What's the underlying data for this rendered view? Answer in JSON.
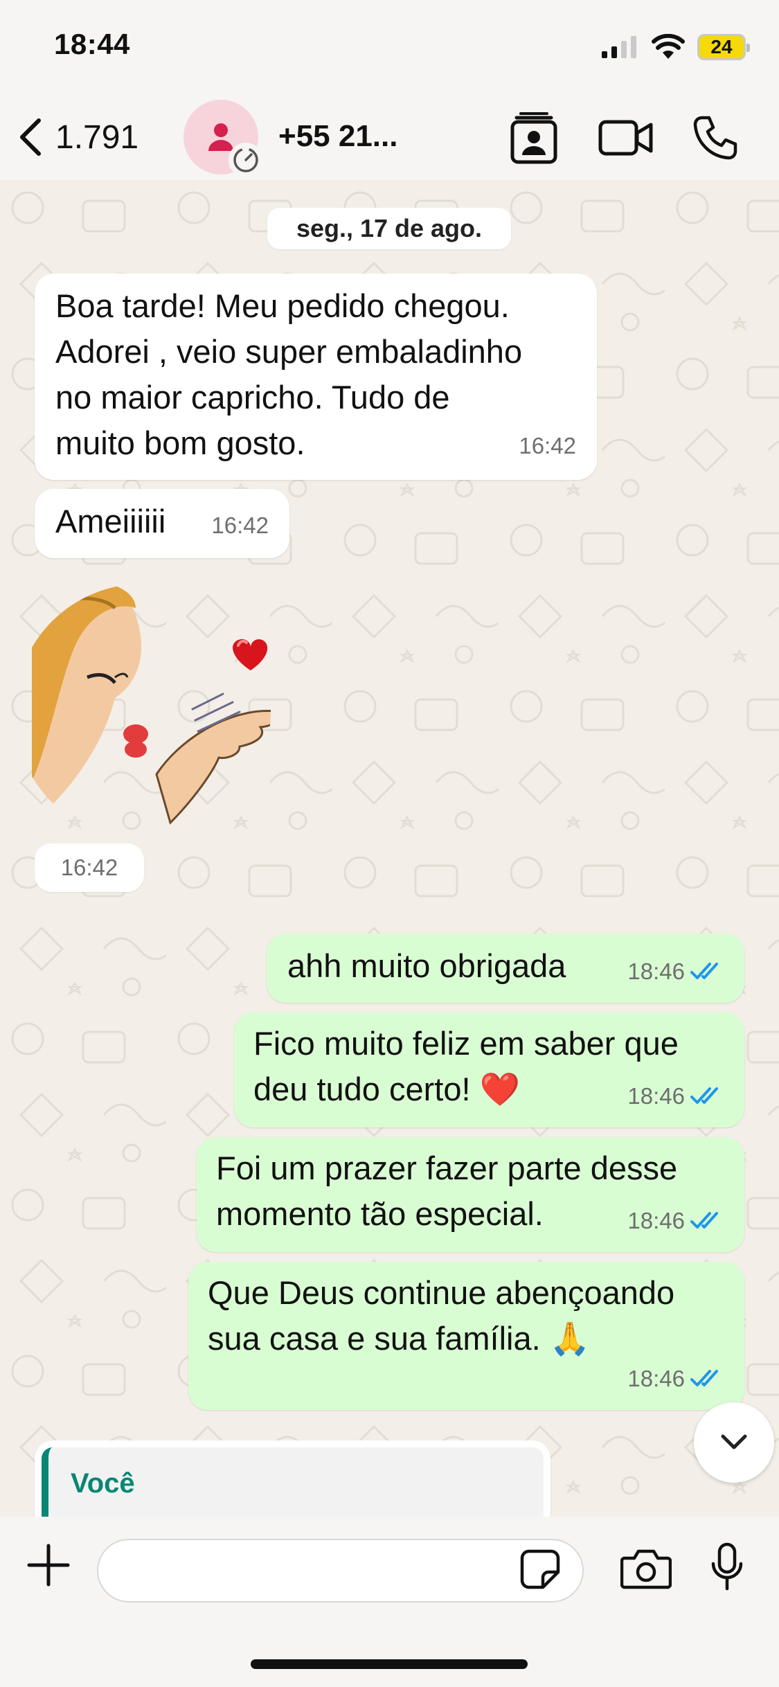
{
  "status_bar": {
    "time": "18:44",
    "battery": "24"
  },
  "header": {
    "back_count": "1.791",
    "contact_name": "+55 21..."
  },
  "chat": {
    "date_chip": "seg., 17 de ago.",
    "messages": [
      {
        "direction": "incoming",
        "text": "Boa tarde! Meu pedido chegou.\nAdorei  , veio super embaladinho\nno maior capricho.  Tudo de\nmuito bom gosto.",
        "time": "16:42"
      },
      {
        "direction": "incoming",
        "text": "Ameiiiiii",
        "time": "16:42"
      },
      {
        "direction": "incoming",
        "type": "sticker",
        "sticker": "kiss-blowing-woman",
        "time": "16:42"
      },
      {
        "direction": "outgoing",
        "text": "ahh muito obrigada",
        "time": "18:46",
        "status": "read"
      },
      {
        "direction": "outgoing",
        "text": "Fico muito feliz em saber que\ndeu tudo certo! ❤️",
        "time": "18:46",
        "status": "read"
      },
      {
        "direction": "outgoing",
        "text": "Foi um prazer fazer parte desse\nmomento tão especial.",
        "time": "18:46",
        "status": "read"
      },
      {
        "direction": "outgoing",
        "text": "Que Deus continue abençoando\nsua casa e sua família. 🙏",
        "time": "18:46",
        "status": "read"
      }
    ],
    "reply_preview": {
      "name": "Você"
    }
  },
  "input": {
    "value": "",
    "placeholder": ""
  },
  "colors": {
    "outgoing_bubble": "#d9fdd3",
    "incoming_bubble": "#ffffff",
    "read_ticks": "#1e97e8",
    "reply_accent": "#078774",
    "chat_background": "#f3efe8"
  },
  "icons": [
    "chevron-left-icon",
    "person-icon",
    "timer-icon",
    "contact-card-icon",
    "video-call-icon",
    "phone-icon",
    "double-check-icon",
    "chevron-down-icon",
    "plus-icon",
    "sticker-icon",
    "camera-icon",
    "mic-icon"
  ]
}
